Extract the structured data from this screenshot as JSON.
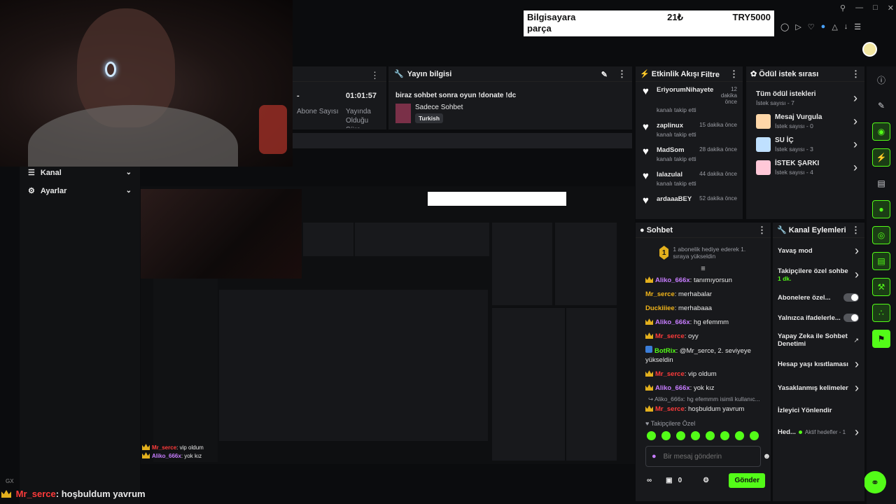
{
  "top_banner": {
    "line1_left": "Bilgisayara",
    "line1_mid": "21₺",
    "line1_right": "TRY5000",
    "line2": "parça"
  },
  "stream_stats": {
    "dash": "-",
    "time": "01:01:57",
    "abone_label": "Abone Sayısı",
    "yayinda_label": "Yayında Olduğu Süre"
  },
  "stream_info": {
    "title": "Yayın bilgisi",
    "stream_title": "biraz sohbet sonra oyun !donate !dc",
    "category": "Sadece Sohbet",
    "language": "Turkish"
  },
  "activity": {
    "title": "Etkinlik Akışı",
    "filter": "Filtre",
    "items": [
      {
        "user": "EriyorumNihayete",
        "time": "12 dakika önce",
        "action": "kanalı takip etti"
      },
      {
        "user": "zaplinux",
        "time": "15 dakika önce",
        "action": "kanalı takip etti"
      },
      {
        "user": "MadSom",
        "time": "28 dakika önce",
        "action": "kanalı takip etti"
      },
      {
        "user": "lalazulal",
        "time": "44 dakika önce",
        "action": "kanalı takip etti"
      },
      {
        "user": "ardaaaBEY",
        "time": "52 dakika önce",
        "action": ""
      }
    ]
  },
  "rewards": {
    "title": "Ödül istek sırası",
    "items": [
      {
        "name": "Tüm ödül istekleri",
        "count": "İstek sayısı - 7"
      },
      {
        "name": "Mesaj Vurgula",
        "count": "İstek sayısı - 0"
      },
      {
        "name": "SU İÇ",
        "count": "İstek sayısı - 3"
      },
      {
        "name": "İSTEK ŞARKI",
        "count": "İstek sayısı - 4"
      }
    ]
  },
  "sidebar": {
    "kanal": "Kanal",
    "ayarlar": "Ayarlar"
  },
  "chat": {
    "title": "Sohbet",
    "pinned": "1 abonelik hediye ederek 1. sıraya yükseldin",
    "pinned_num": "1",
    "messages": [
      {
        "user": "Aliko_666x",
        "text": "tanımıyorsun",
        "color": "#c77dff",
        "crown": true
      },
      {
        "user": "Mr_serce",
        "text": "merhabalar",
        "color": "#f2b51a",
        "crown": false
      },
      {
        "user": "Duckiiiee",
        "text": "merhabaaa",
        "color": "#f2b51a",
        "crown": false
      },
      {
        "user": "Aliko_666x",
        "text": "hg efemmm",
        "color": "#c77dff",
        "crown": true
      },
      {
        "user": "Mr_serce",
        "text": "oyy",
        "color": "#ff3b3b",
        "crown": true
      },
      {
        "user": "BotRix",
        "text": "@Mr_serce, 2. seviyeye yükseldin",
        "color": "#53fc18",
        "crown": false
      },
      {
        "user": "Mr_serce",
        "text": "vip oldum",
        "color": "#ff3b3b",
        "crown": true
      },
      {
        "user": "Aliko_666x",
        "text": "yok kız",
        "color": "#c77dff",
        "crown": true
      }
    ],
    "reply_preview": "Aliko_666x: hg efemmm isimli kullanıc...",
    "last_user": "Mr_serce",
    "last_text": "hoşbuldum yavrum",
    "followers_only": "Takipçilere Özel",
    "input_placeholder": "Bir mesaj gönderin",
    "points": "0",
    "send": "Gönder"
  },
  "channel_actions": {
    "title": "Kanal Eylemleri",
    "items": [
      {
        "label": "Yavaş mod",
        "kind": "chev"
      },
      {
        "label": "Takipçilere özel sohbe",
        "sub": "1 dk.",
        "kind": "chev"
      },
      {
        "label": "Abonelere özel...",
        "kind": "toggle"
      },
      {
        "label": "Yalnızca ifadelerle...",
        "kind": "toggle"
      },
      {
        "label": "Yapay Zeka ile Sohbet Denetimi",
        "kind": "ext"
      },
      {
        "label": "Hesap yaşı kısıtlaması",
        "kind": "chev"
      },
      {
        "label": "Yasaklanmış kelimeler",
        "kind": "chev"
      },
      {
        "label": "İzleyici Yönlendir",
        "kind": "none"
      },
      {
        "label": "Hed...",
        "sub": "Aktif hedefler - 1",
        "kind": "chev"
      }
    ]
  },
  "overlay_chat": [
    {
      "user": "Mr_serce",
      "text": "vip oldum"
    },
    {
      "user": "Aliko_666x",
      "text": "yok kız"
    }
  ],
  "bottom_caption": {
    "user": "Mr_serce",
    "text": "hoşbuldum yavrum",
    "tag": "GX"
  }
}
